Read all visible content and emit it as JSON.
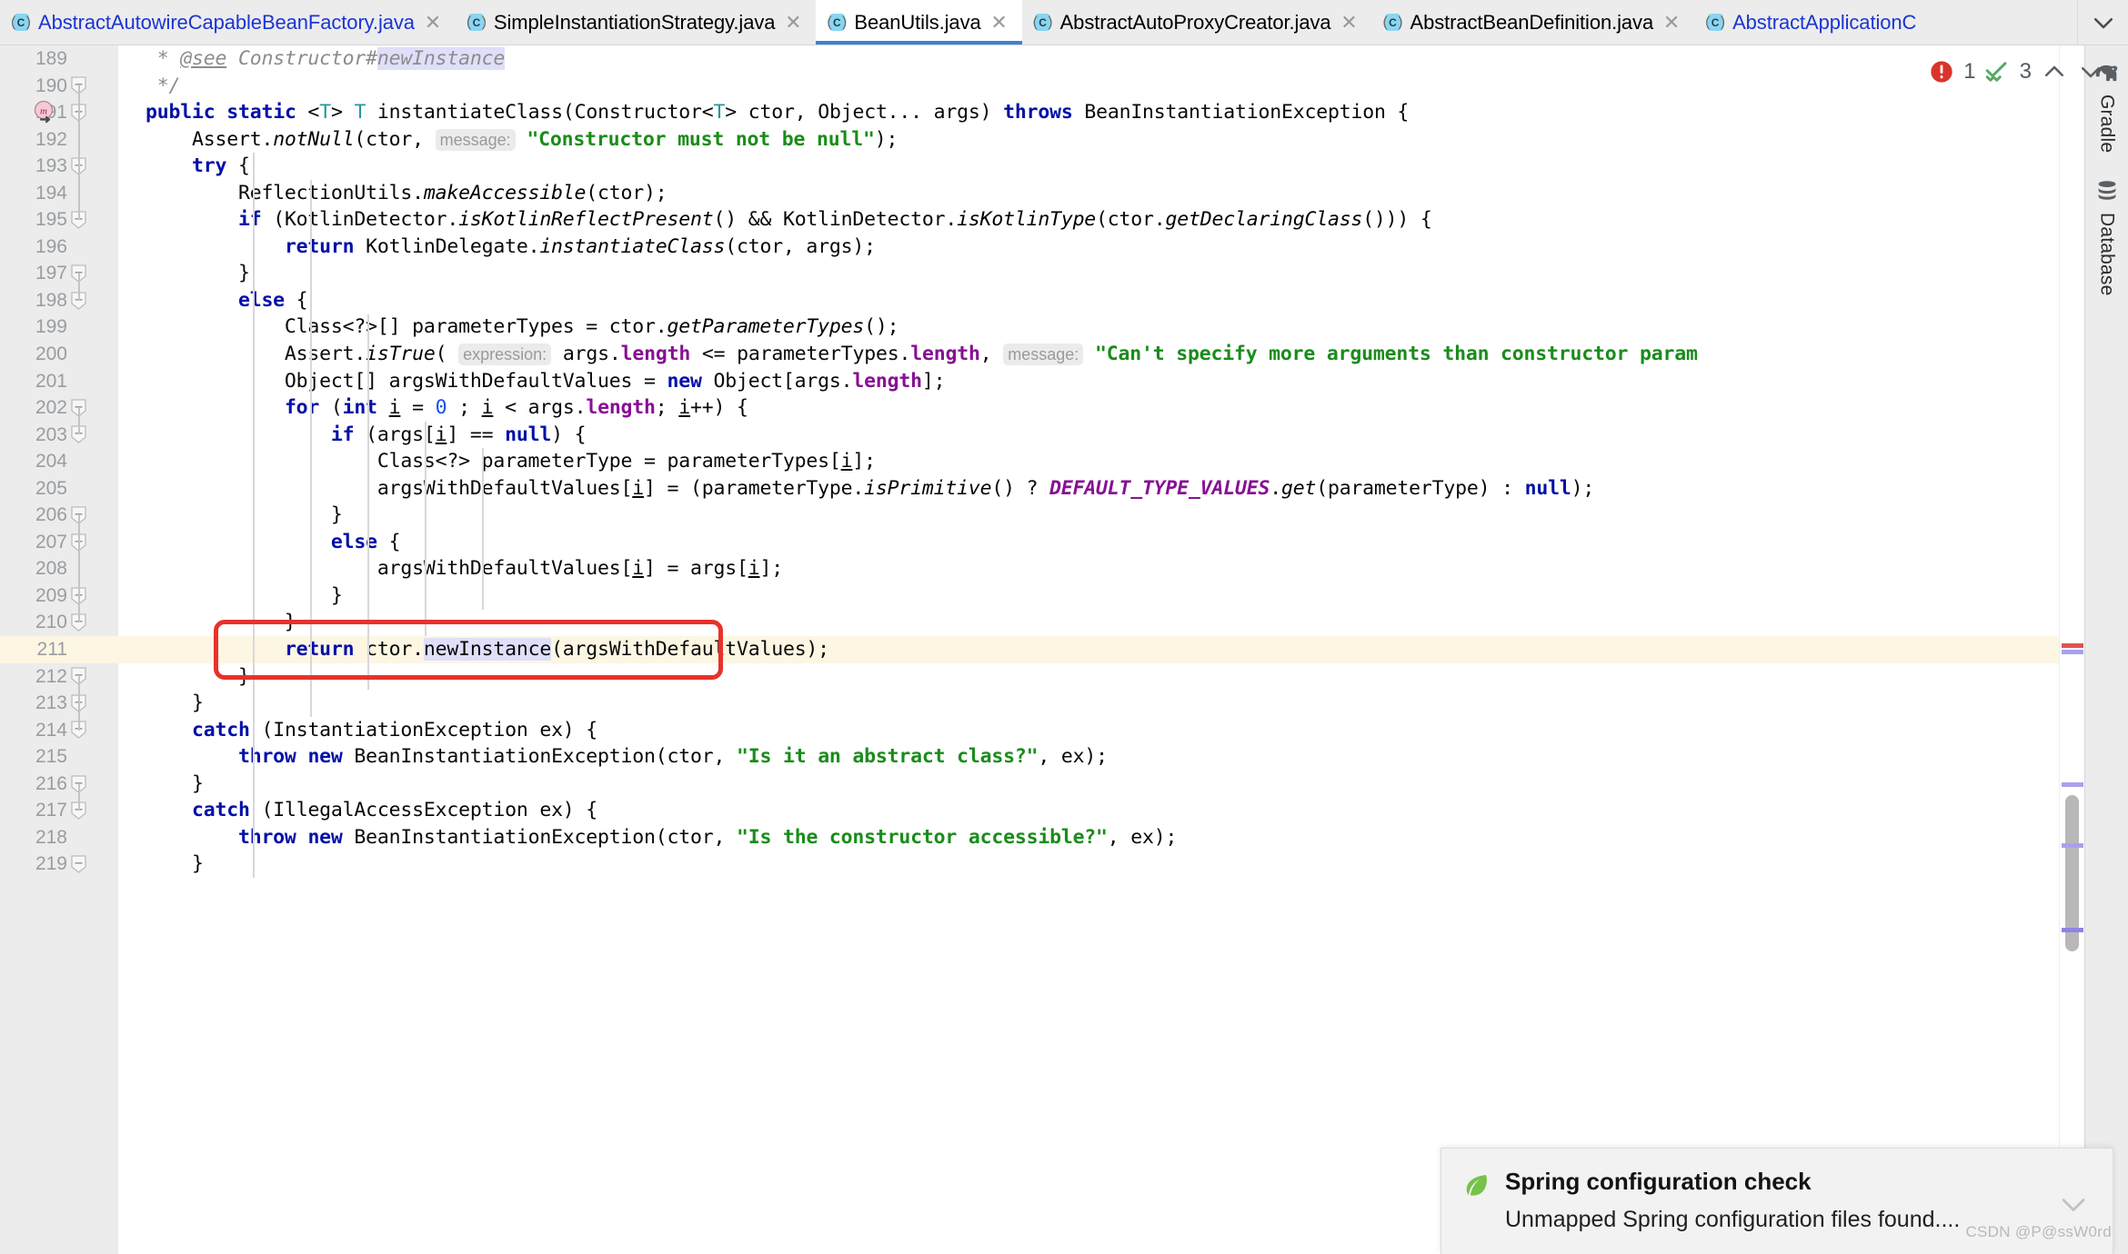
{
  "window": {
    "active_file": "BeanUtils.java"
  },
  "tabs": [
    {
      "label": "AbstractAutowireCapableBeanFactory.java",
      "icon": "java-class-icon",
      "active": false,
      "modified": true
    },
    {
      "label": "SimpleInstantiationStrategy.java",
      "icon": "java-class-icon",
      "active": false,
      "modified": false
    },
    {
      "label": "BeanUtils.java",
      "icon": "java-class-icon",
      "active": true,
      "modified": false
    },
    {
      "label": "AbstractAutoProxyCreator.java",
      "icon": "java-class-icon",
      "active": false,
      "modified": false
    },
    {
      "label": "AbstractBeanDefinition.java",
      "icon": "java-class-icon",
      "active": false,
      "modified": false
    },
    {
      "label": "AbstractApplicationC",
      "icon": "java-class-icon",
      "active": false,
      "modified": true
    }
  ],
  "tab_overflow": {
    "icon": "chevron-down-icon",
    "label": "⌄"
  },
  "inspection_widget": {
    "error_icon": "error-circle-icon",
    "error_count": "1",
    "ok_icon": "inspection-ok-icon",
    "ok_count": "3",
    "prev_icon": "chevron-up-icon",
    "next_icon": "chevron-down-icon"
  },
  "right_toolbar": {
    "items": [
      {
        "label": "Gradle",
        "icon": "gradle-elephant-icon"
      },
      {
        "label": "Database",
        "icon": "database-icon"
      }
    ]
  },
  "notification": {
    "icon": "spring-leaf-icon",
    "title": "Spring configuration check",
    "body": "Unmapped Spring configuration files found....",
    "collapse_icon": "chevron-down-icon"
  },
  "watermark": "CSDN @P@ssW0rd",
  "editor": {
    "first_line": 189,
    "highlighted_line": 211,
    "gutter_marker_line": 191,
    "gutter_marker_icon": "method-override-icon",
    "bulb_line": 211,
    "bulb_icon": "intention-bulb-icon",
    "fold_icon": "fold-minus-icon",
    "annotation_box": {
      "line_start": 211,
      "line_end": 211,
      "color": "#e8312b"
    },
    "colors": {
      "keyword": "#0310a8",
      "string": "#1a8c1a",
      "field": "#871094",
      "comment": "#8c8c8c",
      "type_param": "#20999d",
      "constant": "#871094",
      "hint_bg": "#ebebeb",
      "hint_fg": "#9a9a9a",
      "highlight_line_bg": "#fdf6e3",
      "identifier_highlight_bg": "#dfdffa",
      "tab_active_underline": "#3c82d6"
    },
    "lines": [
      {
        "n": 189,
        "fold": false,
        "text": " * @see Constructor#newInstance"
      },
      {
        "n": 190,
        "fold": true,
        "text": " */"
      },
      {
        "n": 191,
        "fold": true,
        "text": "public static <T> T instantiateClass(Constructor<T> ctor, Object... args) throws BeanInstantiationException {"
      },
      {
        "n": 192,
        "fold": false,
        "text": "    Assert.notNull(ctor, message: \"Constructor must not be null\");"
      },
      {
        "n": 193,
        "fold": true,
        "text": "    try {"
      },
      {
        "n": 194,
        "fold": false,
        "text": "        ReflectionUtils.makeAccessible(ctor);"
      },
      {
        "n": 195,
        "fold": true,
        "text": "        if (KotlinDetector.isKotlinReflectPresent() && KotlinDetector.isKotlinType(ctor.getDeclaringClass())) {"
      },
      {
        "n": 196,
        "fold": false,
        "text": "            return KotlinDelegate.instantiateClass(ctor, args);"
      },
      {
        "n": 197,
        "fold": true,
        "text": "        }"
      },
      {
        "n": 198,
        "fold": true,
        "text": "        else {"
      },
      {
        "n": 199,
        "fold": false,
        "text": "            Class<?>[] parameterTypes = ctor.getParameterTypes();"
      },
      {
        "n": 200,
        "fold": false,
        "text": "            Assert.isTrue( expression: args.length <= parameterTypes.length, message: \"Can't specify more arguments than constructor param"
      },
      {
        "n": 201,
        "fold": false,
        "text": "            Object[] argsWithDefaultValues = new Object[args.length];"
      },
      {
        "n": 202,
        "fold": true,
        "text": "            for (int i = 0 ; i < args.length; i++) {"
      },
      {
        "n": 203,
        "fold": true,
        "text": "                if (args[i] == null) {"
      },
      {
        "n": 204,
        "fold": false,
        "text": "                    Class<?> parameterType = parameterTypes[i];"
      },
      {
        "n": 205,
        "fold": false,
        "text": "                    argsWithDefaultValues[i] = (parameterType.isPrimitive() ? DEFAULT_TYPE_VALUES.get(parameterType) : null);"
      },
      {
        "n": 206,
        "fold": true,
        "text": "                }"
      },
      {
        "n": 207,
        "fold": true,
        "text": "                else {"
      },
      {
        "n": 208,
        "fold": false,
        "text": "                    argsWithDefaultValues[i] = args[i];"
      },
      {
        "n": 209,
        "fold": true,
        "text": "                }"
      },
      {
        "n": 210,
        "fold": true,
        "text": "            }"
      },
      {
        "n": 211,
        "fold": false,
        "text": "            return ctor.newInstance(argsWithDefaultValues);"
      },
      {
        "n": 212,
        "fold": true,
        "text": "        }"
      },
      {
        "n": 213,
        "fold": true,
        "text": "    }"
      },
      {
        "n": 214,
        "fold": true,
        "text": "    catch (InstantiationException ex) {"
      },
      {
        "n": 215,
        "fold": false,
        "text": "        throw new BeanInstantiationException(ctor, \"Is it an abstract class?\", ex);"
      },
      {
        "n": 216,
        "fold": true,
        "text": "    }"
      },
      {
        "n": 217,
        "fold": true,
        "text": "    catch (IllegalAccessException ex) {"
      },
      {
        "n": 218,
        "fold": false,
        "text": "        throw new BeanInstantiationException(ctor, \"Is the constructor accessible?\", ex);"
      },
      {
        "n": 219,
        "fold": true,
        "text": "    }"
      }
    ]
  },
  "scrollbar": {
    "thumb_top_pct": 62,
    "thumb_height_pct": 13,
    "marks": [
      {
        "top_pct": 50,
        "color": "#a9a0ee"
      },
      {
        "top_pct": 61,
        "color": "#a9a0ee"
      },
      {
        "top_pct": 66,
        "color": "#a9a0ee"
      },
      {
        "top_pct": 73,
        "color": "#8f84e0"
      },
      {
        "top_pct": 49.5,
        "color": "#e05252"
      }
    ]
  }
}
